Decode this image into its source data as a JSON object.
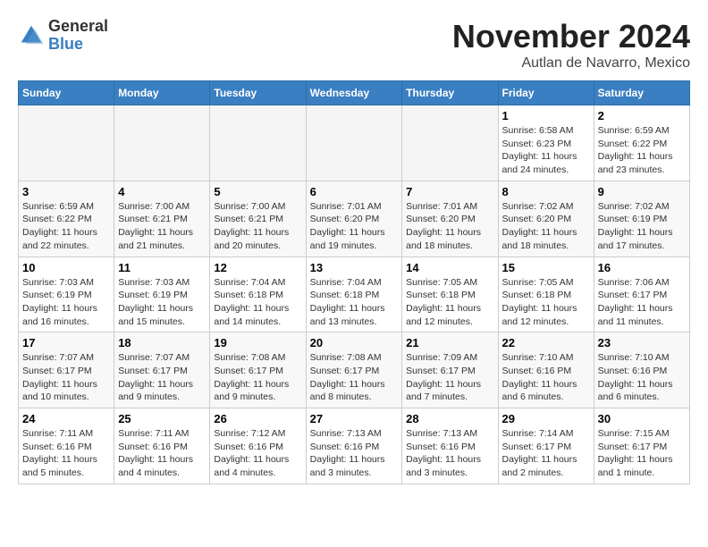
{
  "logo": {
    "general": "General",
    "blue": "Blue"
  },
  "title": "November 2024",
  "location": "Autlan de Navarro, Mexico",
  "weekdays": [
    "Sunday",
    "Monday",
    "Tuesday",
    "Wednesday",
    "Thursday",
    "Friday",
    "Saturday"
  ],
  "weeks": [
    [
      {
        "day": "",
        "empty": true
      },
      {
        "day": "",
        "empty": true
      },
      {
        "day": "",
        "empty": true
      },
      {
        "day": "",
        "empty": true
      },
      {
        "day": "",
        "empty": true
      },
      {
        "day": "1",
        "sunrise": "6:58 AM",
        "sunset": "6:23 PM",
        "daylight": "11 hours and 24 minutes."
      },
      {
        "day": "2",
        "sunrise": "6:59 AM",
        "sunset": "6:22 PM",
        "daylight": "11 hours and 23 minutes."
      }
    ],
    [
      {
        "day": "3",
        "sunrise": "6:59 AM",
        "sunset": "6:22 PM",
        "daylight": "11 hours and 22 minutes."
      },
      {
        "day": "4",
        "sunrise": "7:00 AM",
        "sunset": "6:21 PM",
        "daylight": "11 hours and 21 minutes."
      },
      {
        "day": "5",
        "sunrise": "7:00 AM",
        "sunset": "6:21 PM",
        "daylight": "11 hours and 20 minutes."
      },
      {
        "day": "6",
        "sunrise": "7:01 AM",
        "sunset": "6:20 PM",
        "daylight": "11 hours and 19 minutes."
      },
      {
        "day": "7",
        "sunrise": "7:01 AM",
        "sunset": "6:20 PM",
        "daylight": "11 hours and 18 minutes."
      },
      {
        "day": "8",
        "sunrise": "7:02 AM",
        "sunset": "6:20 PM",
        "daylight": "11 hours and 18 minutes."
      },
      {
        "day": "9",
        "sunrise": "7:02 AM",
        "sunset": "6:19 PM",
        "daylight": "11 hours and 17 minutes."
      }
    ],
    [
      {
        "day": "10",
        "sunrise": "7:03 AM",
        "sunset": "6:19 PM",
        "daylight": "11 hours and 16 minutes."
      },
      {
        "day": "11",
        "sunrise": "7:03 AM",
        "sunset": "6:19 PM",
        "daylight": "11 hours and 15 minutes."
      },
      {
        "day": "12",
        "sunrise": "7:04 AM",
        "sunset": "6:18 PM",
        "daylight": "11 hours and 14 minutes."
      },
      {
        "day": "13",
        "sunrise": "7:04 AM",
        "sunset": "6:18 PM",
        "daylight": "11 hours and 13 minutes."
      },
      {
        "day": "14",
        "sunrise": "7:05 AM",
        "sunset": "6:18 PM",
        "daylight": "11 hours and 12 minutes."
      },
      {
        "day": "15",
        "sunrise": "7:05 AM",
        "sunset": "6:18 PM",
        "daylight": "11 hours and 12 minutes."
      },
      {
        "day": "16",
        "sunrise": "7:06 AM",
        "sunset": "6:17 PM",
        "daylight": "11 hours and 11 minutes."
      }
    ],
    [
      {
        "day": "17",
        "sunrise": "7:07 AM",
        "sunset": "6:17 PM",
        "daylight": "11 hours and 10 minutes."
      },
      {
        "day": "18",
        "sunrise": "7:07 AM",
        "sunset": "6:17 PM",
        "daylight": "11 hours and 9 minutes."
      },
      {
        "day": "19",
        "sunrise": "7:08 AM",
        "sunset": "6:17 PM",
        "daylight": "11 hours and 9 minutes."
      },
      {
        "day": "20",
        "sunrise": "7:08 AM",
        "sunset": "6:17 PM",
        "daylight": "11 hours and 8 minutes."
      },
      {
        "day": "21",
        "sunrise": "7:09 AM",
        "sunset": "6:17 PM",
        "daylight": "11 hours and 7 minutes."
      },
      {
        "day": "22",
        "sunrise": "7:10 AM",
        "sunset": "6:16 PM",
        "daylight": "11 hours and 6 minutes."
      },
      {
        "day": "23",
        "sunrise": "7:10 AM",
        "sunset": "6:16 PM",
        "daylight": "11 hours and 6 minutes."
      }
    ],
    [
      {
        "day": "24",
        "sunrise": "7:11 AM",
        "sunset": "6:16 PM",
        "daylight": "11 hours and 5 minutes."
      },
      {
        "day": "25",
        "sunrise": "7:11 AM",
        "sunset": "6:16 PM",
        "daylight": "11 hours and 4 minutes."
      },
      {
        "day": "26",
        "sunrise": "7:12 AM",
        "sunset": "6:16 PM",
        "daylight": "11 hours and 4 minutes."
      },
      {
        "day": "27",
        "sunrise": "7:13 AM",
        "sunset": "6:16 PM",
        "daylight": "11 hours and 3 minutes."
      },
      {
        "day": "28",
        "sunrise": "7:13 AM",
        "sunset": "6:16 PM",
        "daylight": "11 hours and 3 minutes."
      },
      {
        "day": "29",
        "sunrise": "7:14 AM",
        "sunset": "6:17 PM",
        "daylight": "11 hours and 2 minutes."
      },
      {
        "day": "30",
        "sunrise": "7:15 AM",
        "sunset": "6:17 PM",
        "daylight": "11 hours and 1 minute."
      }
    ]
  ]
}
